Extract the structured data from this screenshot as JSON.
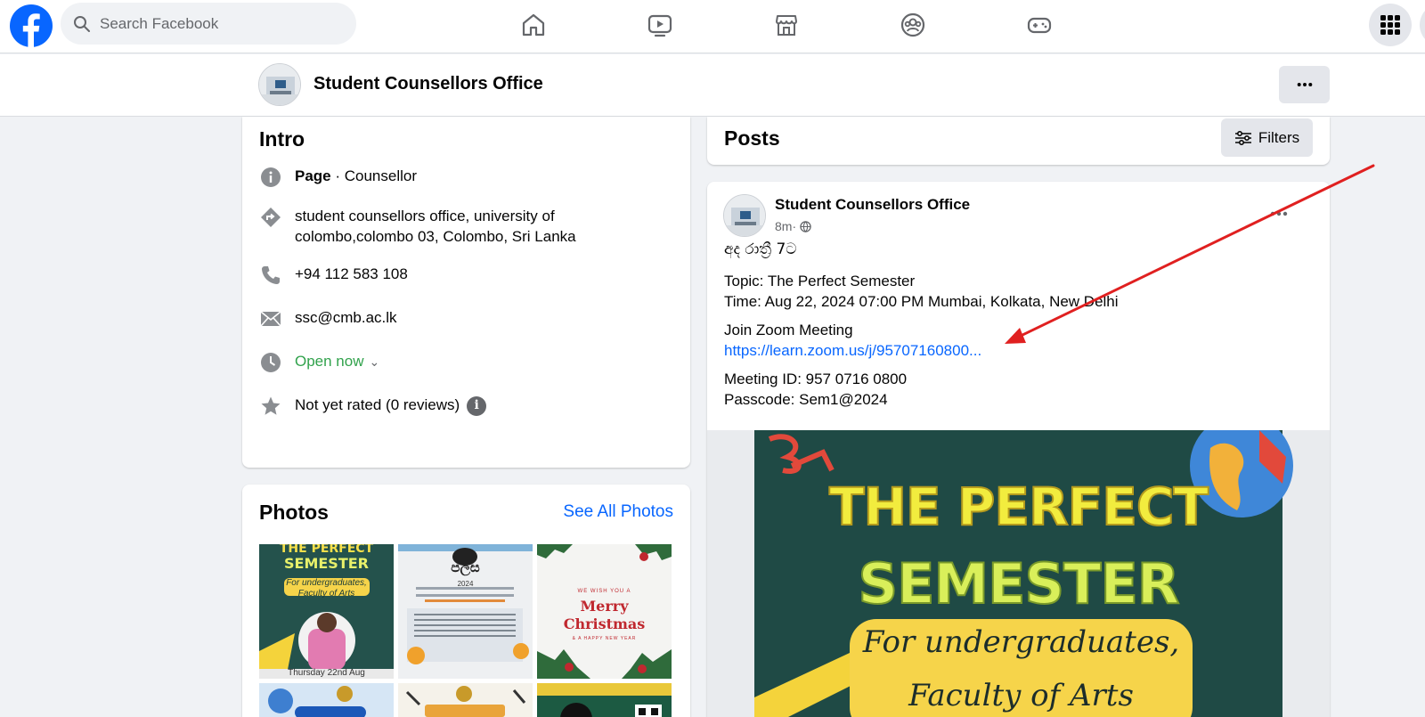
{
  "topnav": {
    "search_placeholder": "Search Facebook",
    "icons": [
      "home-icon",
      "video-icon",
      "marketplace-icon",
      "groups-icon",
      "gaming-icon",
      "menu-grid-icon"
    ],
    "accent": "#0866ff"
  },
  "page_header": {
    "name": "Student Counsellors Office",
    "more_label": "···"
  },
  "intro": {
    "title": "Intro",
    "category_prefix": "Page",
    "category_sep": " · ",
    "category": "Counsellor",
    "address": "student counsellors office, university of colombo,colombo 03, Colombo, Sri Lanka",
    "phone": "+94 112 583 108",
    "email": "ssc@cmb.ac.lk",
    "hours": "Open now",
    "rating": "Not yet rated (0 reviews)",
    "status_color": "#31a24c"
  },
  "photos": {
    "title": "Photos",
    "see_all": "See All Photos",
    "tiles": [
      {
        "t1": "THE PERFECT",
        "t2": "SEMESTER",
        "t3": "For undergraduates,",
        "t4": "Faculty of Arts",
        "t5": "Thursday 22nd Aug"
      },
      {
        "t1": "පලස",
        "t2": "2024"
      },
      {
        "t1": "WE WISH YOU A",
        "t2": "Merry",
        "t3": "Christmas",
        "t4": "& A HAPPY NEW YEAR"
      }
    ]
  },
  "posts": {
    "title": "Posts",
    "filters_label": "Filters"
  },
  "post": {
    "author": "Student Counsellors Office",
    "time": "8m",
    "time_sep": " · ",
    "more_label": "···",
    "line1": "අද රාත්‍රී 7ට",
    "topic": "Topic: The Perfect Semester",
    "time_line": "Time: Aug 22, 2024 07:00 PM Mumbai, Kolkata, New Delhi",
    "join": "Join Zoom Meeting",
    "link": "https://learn.zoom.us/j/95707160800...",
    "meeting_id": "Meeting ID: 957 0716 0800",
    "passcode": "Passcode: Sem1@2024",
    "image": {
      "title1": "THE PERFECT",
      "title2": "SEMESTER",
      "sub1": "For undergraduates,",
      "sub2": "Faculty of Arts"
    }
  },
  "annotation": {
    "arrow_color": "#e02020"
  }
}
